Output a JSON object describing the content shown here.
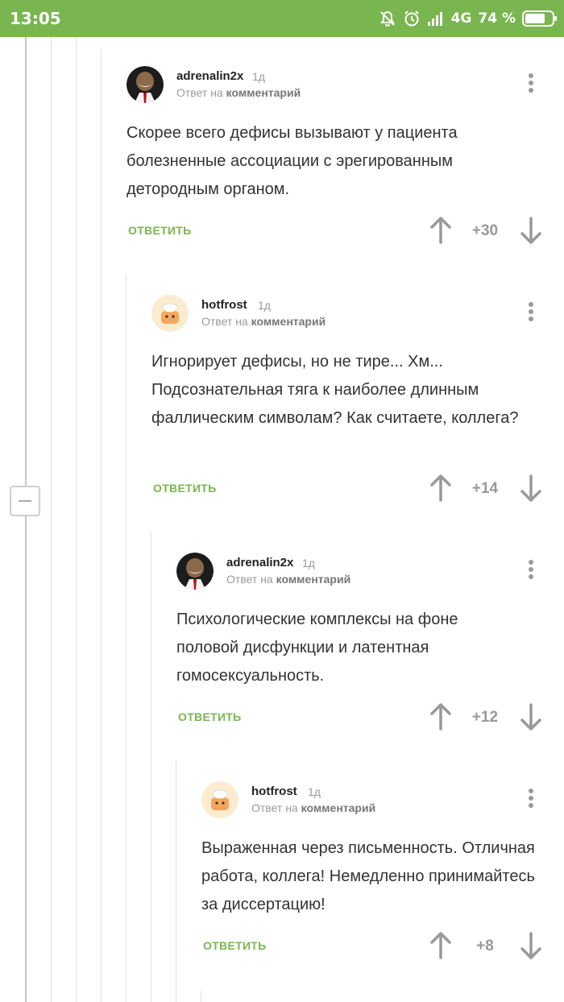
{
  "status_bar": {
    "time": "13:05",
    "network": "4G",
    "battery_percent": "74 %",
    "battery_level": 0.74,
    "icons": [
      "mute-icon",
      "alarm-icon",
      "signal-icon",
      "battery-icon"
    ]
  },
  "colors": {
    "accent": "#79b64f",
    "text": "#333333",
    "muted": "#9a9a9a"
  },
  "comments": [
    {
      "author": "adrenalin2x",
      "time": "1д",
      "reply_prefix": "Ответ на",
      "reply_target": "комментарий",
      "text": "Скорее всего дефисы вызывают у пациента болезненные ассоциации с эрегированным детородным органом.",
      "reply_label": "ОТВЕТИТЬ",
      "score": "+30"
    },
    {
      "author": "hotfrost",
      "time": "1д",
      "reply_prefix": "Ответ на",
      "reply_target": "комментарий",
      "text": "Игнорирует дефисы, но не тире... Хм... Подсознательная тяга к наиболее длинным фаллическим символам? Как считаете, коллега?",
      "reply_label": "ОТВЕТИТЬ",
      "score": "+14"
    },
    {
      "author": "adrenalin2x",
      "time": "1д",
      "reply_prefix": "Ответ на",
      "reply_target": "комментарий",
      "text": "Психологические комплексы на фоне половой дисфункции и латентная гомосексуальность.",
      "reply_label": "ОТВЕТИТЬ",
      "score": "+12"
    },
    {
      "author": "hotfrost",
      "time": "1д",
      "reply_prefix": "Ответ на",
      "reply_target": "комментарий",
      "text": "Выраженная через письменность. Отличная работа, коллега! Немедленно принимайтесь за диссертацию!",
      "reply_label": "ОТВЕТИТЬ",
      "score": "+8"
    }
  ]
}
